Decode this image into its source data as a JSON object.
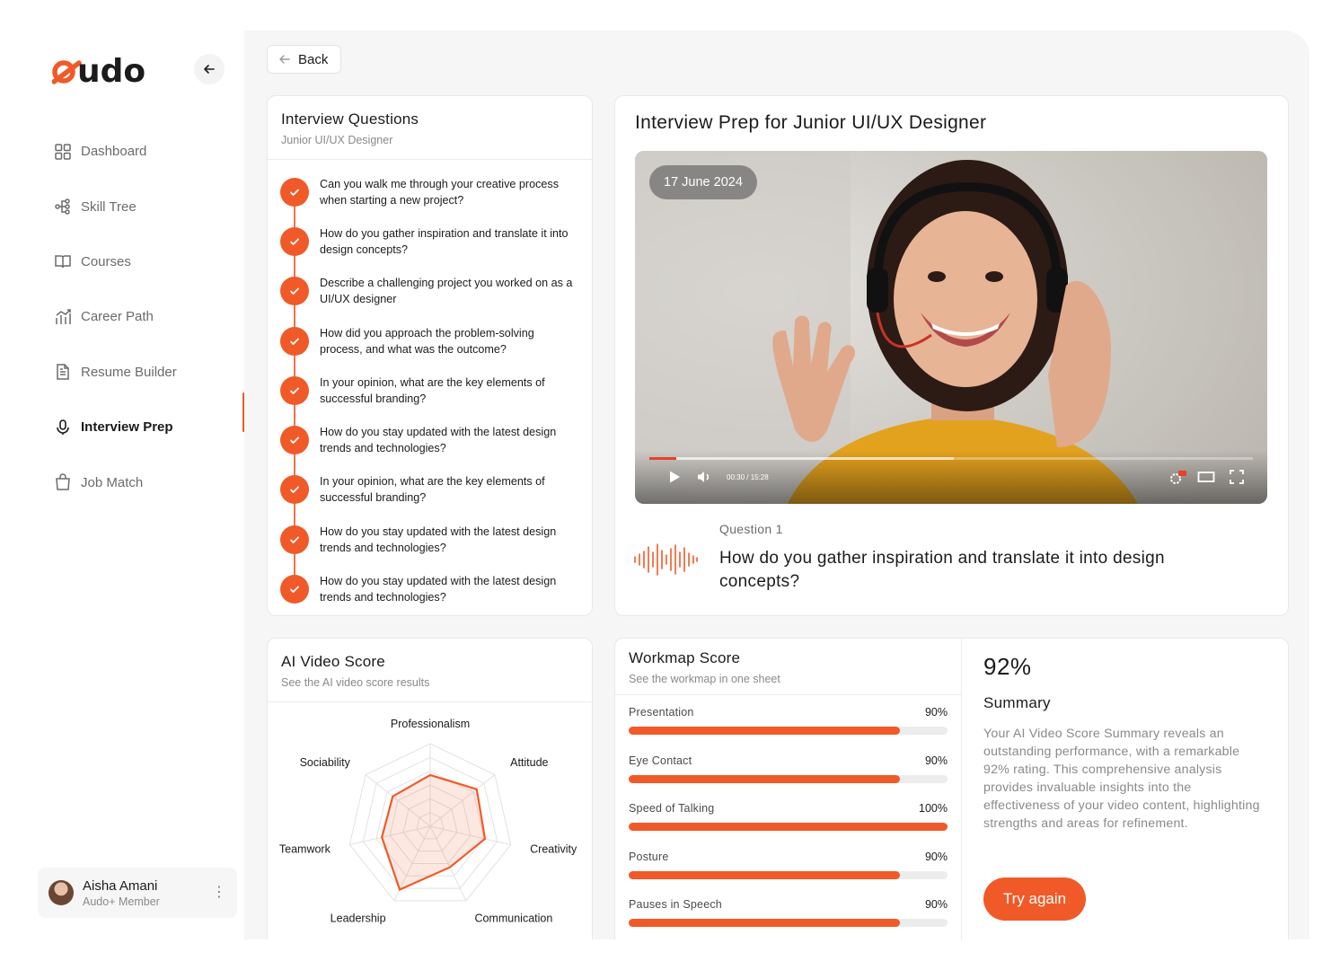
{
  "brand": {
    "logo_text": "audo",
    "accent": "#f05a28"
  },
  "sidebar": {
    "items": [
      {
        "label": "Dashboard",
        "icon": "grid-icon"
      },
      {
        "label": "Skill Tree",
        "icon": "tree-icon"
      },
      {
        "label": "Courses",
        "icon": "book-icon"
      },
      {
        "label": "Career Path",
        "icon": "career-path-icon"
      },
      {
        "label": "Resume Builder",
        "icon": "document-icon"
      },
      {
        "label": "Interview Prep",
        "icon": "microphone-icon",
        "active": true
      },
      {
        "label": "Job Match",
        "icon": "bag-icon"
      }
    ],
    "user": {
      "name": "Aisha Amani",
      "role": "Audo+ Member"
    }
  },
  "back_label": "Back",
  "questions": {
    "title": "Interview Questions",
    "subtitle": "Junior UI/UX Designer",
    "items": [
      "Can you walk me through your creative process when starting a new project?",
      "How do you gather inspiration and translate it into design concepts?",
      "Describe a challenging project you worked on as a UI/UX designer",
      "How did you approach the problem-solving process, and what was the outcome?",
      "In your opinion, what are the key elements of successful branding?",
      "How do you stay updated with the latest design trends and technologies?",
      "In your opinion, what are the key elements of successful branding?",
      "How do you stay updated with the latest design trends and technologies?",
      "How do you stay updated with the latest design trends and technologies?"
    ]
  },
  "video": {
    "title": "Interview Prep for Junior UI/UX Designer",
    "date": "17 June 2024",
    "time": "00:30 / 15:28",
    "progress": 0.045,
    "buffered": 0.505,
    "question_label": "Question 1",
    "question_text": "How do you gather inspiration and translate it into design concepts?"
  },
  "ai_score": {
    "title": "AI Video Score",
    "subtitle": "See the AI video score results",
    "axes": [
      "Professionalism",
      "Attitude",
      "Creativity",
      "Communication",
      "Leadership",
      "Teamwork",
      "Sociability"
    ],
    "values": [
      0.62,
      0.72,
      0.68,
      0.55,
      0.85,
      0.6,
      0.58
    ]
  },
  "workmap": {
    "title": "Workmap Score",
    "subtitle": "See the workmap in one sheet",
    "rows": [
      {
        "name": "Presentation",
        "value": "90%",
        "pct": 85
      },
      {
        "name": "Eye Contact",
        "value": "90%",
        "pct": 85
      },
      {
        "name": "Speed of Talking",
        "value": "100%",
        "pct": 100
      },
      {
        "name": "Posture",
        "value": "90%",
        "pct": 85
      },
      {
        "name": "Pauses in Speech",
        "value": "90%",
        "pct": 85
      }
    ]
  },
  "summary": {
    "percent": "92%",
    "title": "Summary",
    "text": "Your AI Video Score Summary reveals an outstanding performance, with a remarkable 92% rating. This comprehensive analysis provides invaluable insights into the effectiveness of your video content, highlighting strengths and areas for refinement.",
    "button": "Try again"
  }
}
